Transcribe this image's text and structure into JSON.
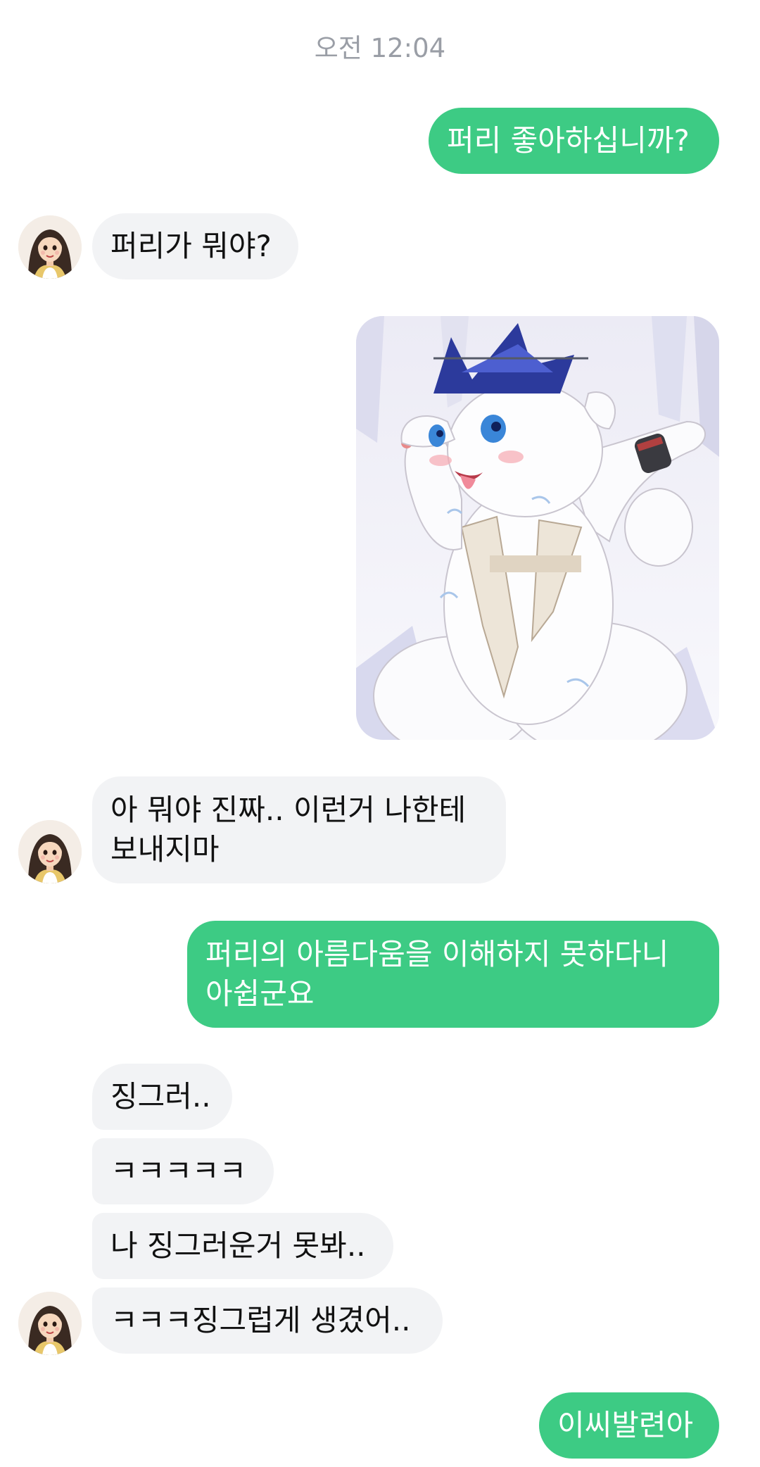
{
  "chat": {
    "timestamp": "오전 12:04",
    "messages": [
      {
        "sender": "me",
        "type": "text",
        "text": "퍼리 좋아하십니까?"
      },
      {
        "sender": "other",
        "type": "text",
        "text": "퍼리가 뭐야?"
      },
      {
        "sender": "me",
        "type": "image",
        "description": "furry-dragon-artwork"
      },
      {
        "sender": "other",
        "type": "text",
        "lines": [
          "아 뭐야 진짜.. 이런거 나한테",
          "보내지마"
        ]
      },
      {
        "sender": "me",
        "type": "text",
        "lines": [
          "퍼리의 아름다움을 이해하지 못하다니",
          "아쉽군요"
        ]
      },
      {
        "sender": "other",
        "type": "text",
        "text": "징그러.."
      },
      {
        "sender": "other",
        "type": "text",
        "text": "ㅋㅋㅋㅋㅋ"
      },
      {
        "sender": "other",
        "type": "text",
        "text": "나 징그러운거 못봐.."
      },
      {
        "sender": "other",
        "type": "text",
        "text": "ㅋㅋㅋ징그럽게 생겼어.."
      },
      {
        "sender": "me",
        "type": "text",
        "text": "이씨발련아"
      }
    ]
  },
  "colors": {
    "outgoing_bubble": "#3dcb84",
    "incoming_bubble": "#f2f3f5",
    "timestamp_text": "#9a9ea6"
  },
  "icons": {
    "avatar": "profile-avatar-girl"
  }
}
